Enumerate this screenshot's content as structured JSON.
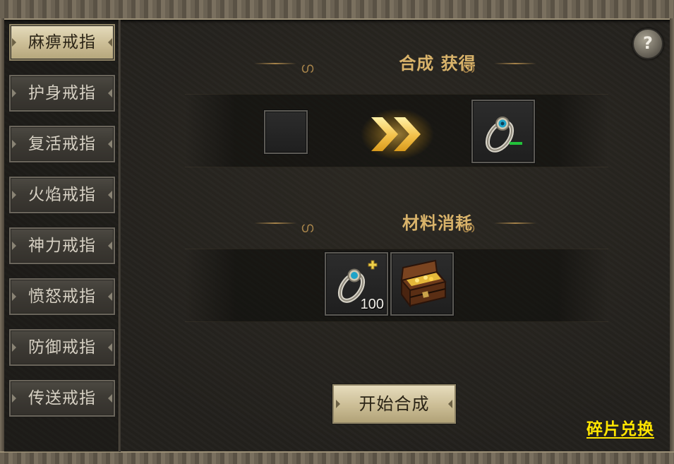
{
  "sidebar": {
    "items": [
      {
        "label": "麻痹戒指",
        "active": true
      },
      {
        "label": "护身戒指",
        "active": false
      },
      {
        "label": "复活戒指",
        "active": false
      },
      {
        "label": "火焰戒指",
        "active": false
      },
      {
        "label": "神力戒指",
        "active": false
      },
      {
        "label": "愤怒戒指",
        "active": false
      },
      {
        "label": "防御戒指",
        "active": false
      },
      {
        "label": "传送戒指",
        "active": false
      }
    ]
  },
  "help": {
    "label": "?"
  },
  "synthesis": {
    "title": "合成 获得",
    "source_slot": {
      "icon": "empty-slot"
    },
    "result_slot": {
      "icon": "ring-icon"
    }
  },
  "materials": {
    "title": "材料消耗",
    "items": [
      {
        "icon": "ring-fragment-icon",
        "count": "100"
      },
      {
        "icon": "treasure-chest-icon",
        "count": ""
      }
    ]
  },
  "actions": {
    "start_label": "开始合成",
    "fragment_exchange_label": "碎片兑换"
  },
  "colors": {
    "accent_gold": "#d9b36a",
    "link_yellow": "#ffe600",
    "active_button": "#cbbd95"
  }
}
